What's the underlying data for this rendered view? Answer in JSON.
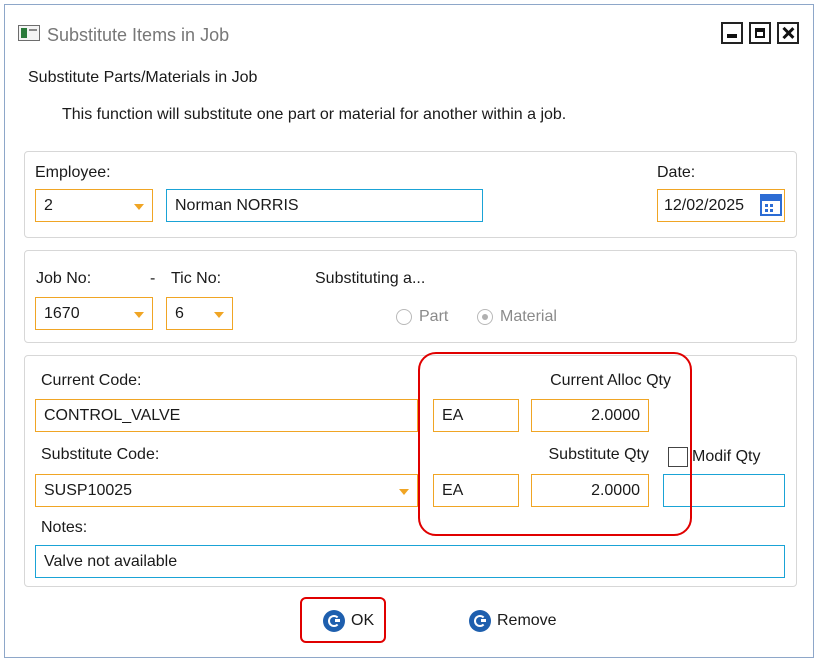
{
  "window": {
    "title": "Substitute Items in Job"
  },
  "heading": "Substitute Parts/Materials in Job",
  "description": "This function will substitute one part or material for another within a job.",
  "employee": {
    "label": "Employee:",
    "code": "2",
    "name": "Norman NORRIS"
  },
  "date": {
    "label": "Date:",
    "value": "12/02/2025"
  },
  "job": {
    "job_label": "Job No:",
    "separator": "-",
    "tic_label": "Tic No:",
    "job_value": "1670",
    "tic_value": "6",
    "substituting_label": "Substituting a...",
    "option_part": "Part",
    "option_material": "Material",
    "selected": "Material"
  },
  "current": {
    "label": "Current Code:",
    "code": "CONTROL_VALVE",
    "unit": "EA",
    "qty_label": "Current Alloc Qty",
    "qty": "2.0000"
  },
  "substitute": {
    "label": "Substitute Code:",
    "code": "SUSP10025",
    "unit": "EA",
    "qty_label": "Substitute Qty",
    "qty": "2.0000",
    "modif_label": "Modif Qty",
    "modif_value": ""
  },
  "notes": {
    "label": "Notes:",
    "value": "Valve not available"
  },
  "buttons": {
    "ok": "OK",
    "remove": "Remove"
  },
  "colors": {
    "field_border": "#f0a524",
    "focus_border": "#1aa3d6",
    "highlight": "#e00000",
    "button_icon": "#1e5fae"
  }
}
